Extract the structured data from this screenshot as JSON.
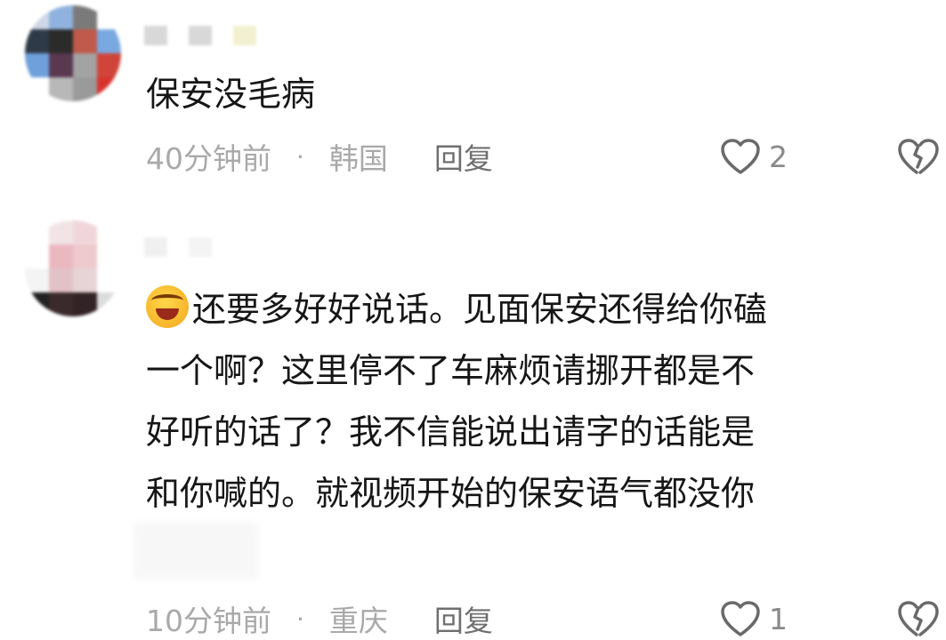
{
  "comments": [
    {
      "text": "保安没毛病",
      "time": "40分钟前",
      "separator": "·",
      "location": "韩国",
      "reply_label": "回复",
      "like_count": "2",
      "avatar_colors": [
        "#cfd8e8",
        "#8fb3de",
        "#7a7a7a",
        "#ffffff",
        "#2f3a48",
        "#2b2b2b",
        "#c05a4a",
        "#7aa8e0",
        "#6fa0dc",
        "#5a3850",
        "#a3a3a3",
        "#d0443a",
        "#ffffff",
        "#b8b8b8",
        "#9a9a9a",
        "#d8342e"
      ]
    },
    {
      "emoji": "rofl-emoji",
      "text": "还要多好好说话。见面保安还得给你磕\n一个啊？这里停不了车麻烦请挪开都是不\n好听的话了？我不信能说出请字的话能是\n和你喊的。就视频开始的保安语气都没你",
      "time": "10分钟前",
      "separator": "·",
      "location": "重庆",
      "reply_label": "回复",
      "like_count": "1",
      "avatar_colors": [
        "#ffffff",
        "#f2e4e6",
        "#f0d6da",
        "#ffffff",
        "#ffffff",
        "#e9b9bf",
        "#eec9cd",
        "#ffffff",
        "#f4f4f4",
        "#e2c2c6",
        "#e7d4d6",
        "#ffffff",
        "#222222",
        "#3a2a2c",
        "#322426",
        "#dcdcdc"
      ]
    }
  ],
  "icons": {
    "like": "heart-outline-icon",
    "dislike": "broken-heart-outline-icon"
  },
  "colors": {
    "text": "#161616",
    "meta": "#a9a9a9",
    "reply": "#6f6f6f",
    "icon": "#6a6a6a"
  }
}
